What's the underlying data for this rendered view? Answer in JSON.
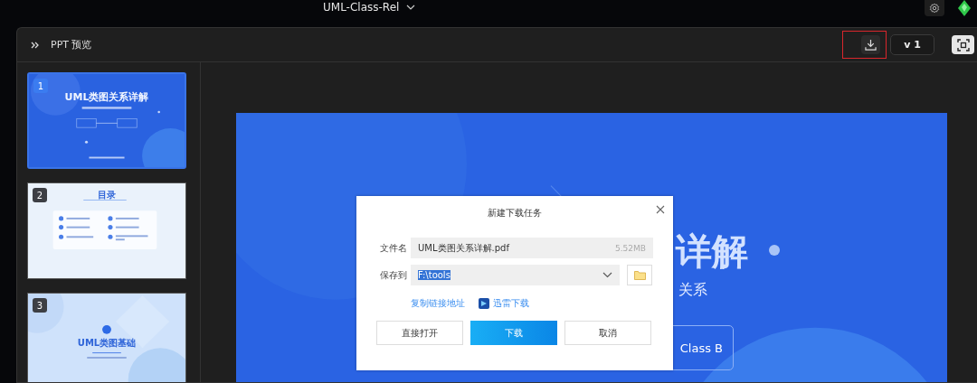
{
  "app": {
    "title": "UML-Class-Rel"
  },
  "panel": {
    "title": "PPT 预览",
    "version": "v 1",
    "download_highlighted": true
  },
  "slides": [
    {
      "number": "1",
      "selected": true,
      "kind": "title",
      "title": "UML类图关系详解"
    },
    {
      "number": "2",
      "selected": false,
      "kind": "toc",
      "title": "目录"
    },
    {
      "number": "3",
      "selected": false,
      "kind": "section",
      "title": "UML类图基础"
    }
  ],
  "slide_view": {
    "title_visible": "详解",
    "subtitle_visible": "关系",
    "node": "Class B"
  },
  "dialog": {
    "title": "新建下载任务",
    "filename_label": "文件名",
    "filename": "UML类图关系详解.pdf",
    "size": "5.52MB",
    "save_label": "保存到",
    "save_path": "F:\\tools",
    "path_selected": true,
    "links": [
      {
        "label": "复制链接地址",
        "kind": "copy"
      },
      {
        "label": "迅雷下载",
        "kind": "thunder"
      }
    ],
    "buttons": [
      {
        "label": "直接打开",
        "kind": "default"
      },
      {
        "label": "下载",
        "kind": "primary"
      },
      {
        "label": "取消",
        "kind": "default"
      }
    ]
  }
}
